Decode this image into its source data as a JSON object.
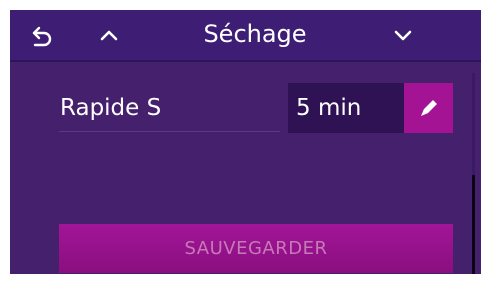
{
  "header": {
    "title": "Séchage",
    "back_icon": "undo-arrow-icon",
    "prev_icon": "chevron-up-icon",
    "next_icon": "chevron-down-icon"
  },
  "setting": {
    "label": "Rapide S",
    "value": "5 min",
    "edit_icon": "pencil-icon"
  },
  "actions": {
    "save_label": "SAUVEGARDER",
    "save_enabled": false
  },
  "colors": {
    "background": "#45206d",
    "header": "#3e1e74",
    "accent": "#a41394",
    "value_field": "#2e1254"
  }
}
